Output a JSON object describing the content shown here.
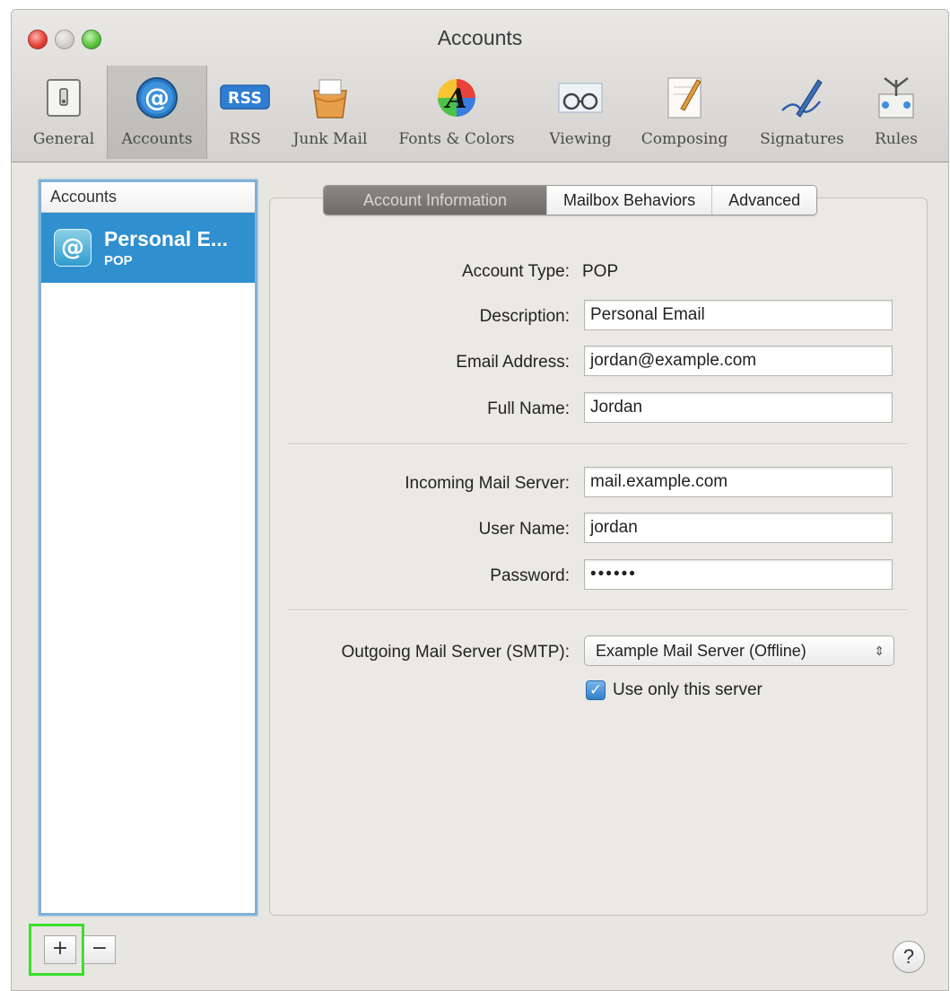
{
  "window": {
    "title": "Accounts"
  },
  "toolbar": {
    "items": [
      {
        "label": "General",
        "icon": "general-switch-icon"
      },
      {
        "label": "Accounts",
        "icon": "at-sign-icon",
        "selected": true
      },
      {
        "label": "RSS",
        "icon": "rss-icon"
      },
      {
        "label": "Junk Mail",
        "icon": "junk-mail-icon"
      },
      {
        "label": "Fonts & Colors",
        "icon": "fonts-colors-icon"
      },
      {
        "label": "Viewing",
        "icon": "viewing-glasses-icon"
      },
      {
        "label": "Composing",
        "icon": "composing-pen-icon"
      },
      {
        "label": "Signatures",
        "icon": "signature-pen-icon"
      },
      {
        "label": "Rules",
        "icon": "rules-icon"
      }
    ]
  },
  "sidebar": {
    "header": "Accounts",
    "accounts": [
      {
        "name": "Personal E...",
        "type": "POP",
        "selected": true
      }
    ],
    "add_label": "+",
    "remove_label": "−"
  },
  "tabs": [
    {
      "label": "Account Information",
      "active": true
    },
    {
      "label": "Mailbox Behaviors"
    },
    {
      "label": "Advanced"
    }
  ],
  "form": {
    "account_type_label": "Account Type:",
    "account_type_value": "POP",
    "description_label": "Description:",
    "description_value": "Personal Email",
    "email_label": "Email Address:",
    "email_value": "jordan@example.com",
    "fullname_label": "Full Name:",
    "fullname_value": "Jordan",
    "incoming_label": "Incoming Mail Server:",
    "incoming_value": "mail.example.com",
    "username_label": "User Name:",
    "username_value": "jordan",
    "password_label": "Password:",
    "password_value": "••••••",
    "smtp_label": "Outgoing Mail Server (SMTP):",
    "smtp_value": "Example Mail Server (Offline)",
    "use_only_label": "Use only this server",
    "use_only_checked": true
  },
  "help_label": "?",
  "colors": {
    "selection_blue": "#2f8fcf",
    "highlight_green": "#37e02b"
  }
}
